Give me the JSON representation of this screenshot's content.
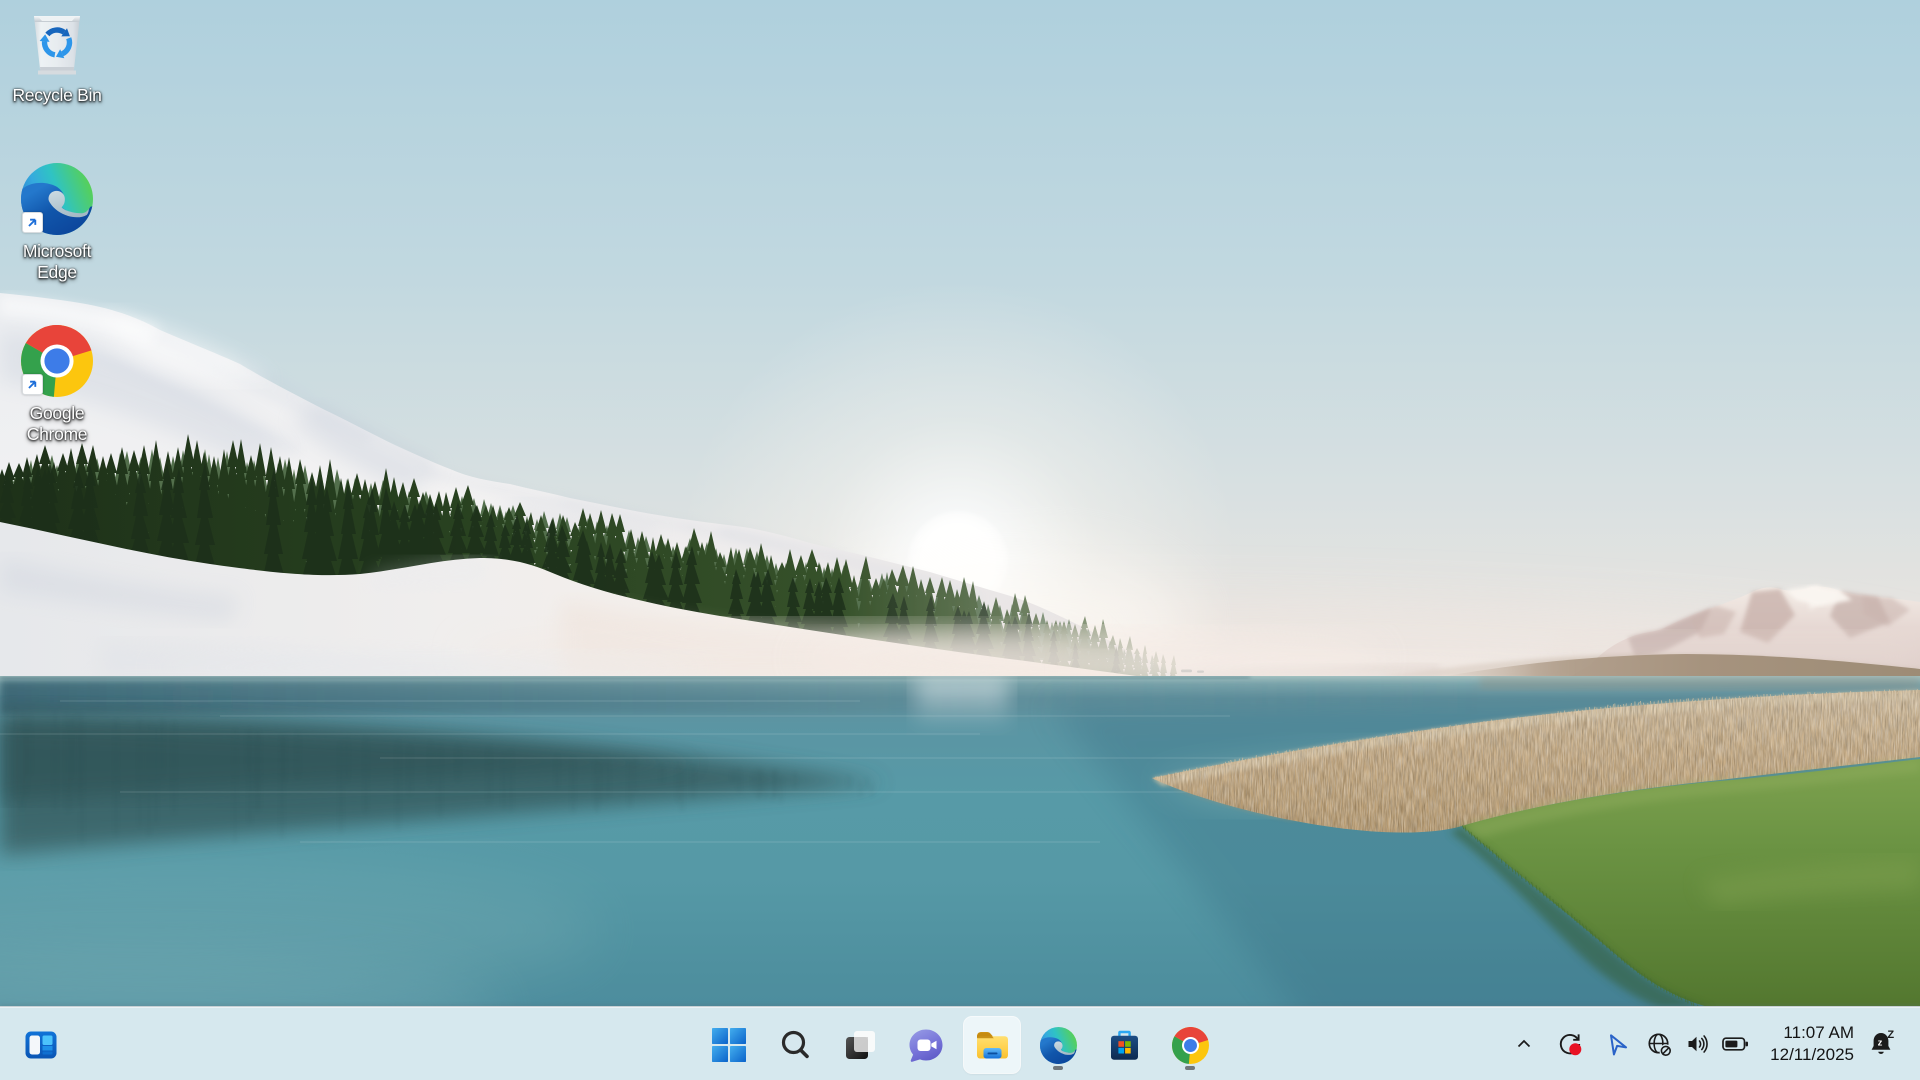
{
  "os": "Windows 11 desktop",
  "wallpaper": {
    "description": "calm lake at sunrise with snowy glacier shore, pine forest, distant mountains, wheat field and green grass",
    "sky_top": "#b2d3e0",
    "sky_horizon": "#ece6e1",
    "water_mid": "#5aa0ae",
    "wheat": "#cdb592",
    "grass": "#6f9a48",
    "snow": "#f3f1ef"
  },
  "desktop": {
    "icons": [
      {
        "id": "recycle-bin",
        "label": "Recycle Bin"
      },
      {
        "id": "microsoft-edge",
        "label": "Microsoft Edge"
      },
      {
        "id": "google-chrome",
        "label": "Google Chrome"
      }
    ]
  },
  "taskbar": {
    "background": "#d6e8ee",
    "widgets_button": {
      "icon": "widgets"
    },
    "center_buttons": [
      {
        "icon": "start"
      },
      {
        "icon": "search"
      },
      {
        "icon": "task-view"
      },
      {
        "icon": "chat"
      },
      {
        "icon": "file-explorer",
        "highlighted": true
      },
      {
        "icon": "edge",
        "running": true
      },
      {
        "icon": "microsoft-store"
      },
      {
        "icon": "chrome",
        "running": true
      }
    ],
    "tray": {
      "icons": [
        "hidden-icons-chevron",
        "sync-recording",
        "location",
        "globe-no-internet",
        "volume",
        "battery"
      ],
      "clock": {
        "time": "11:07 AM",
        "date": "12/11/2025"
      },
      "bell": "notification-bell-dnd"
    }
  }
}
